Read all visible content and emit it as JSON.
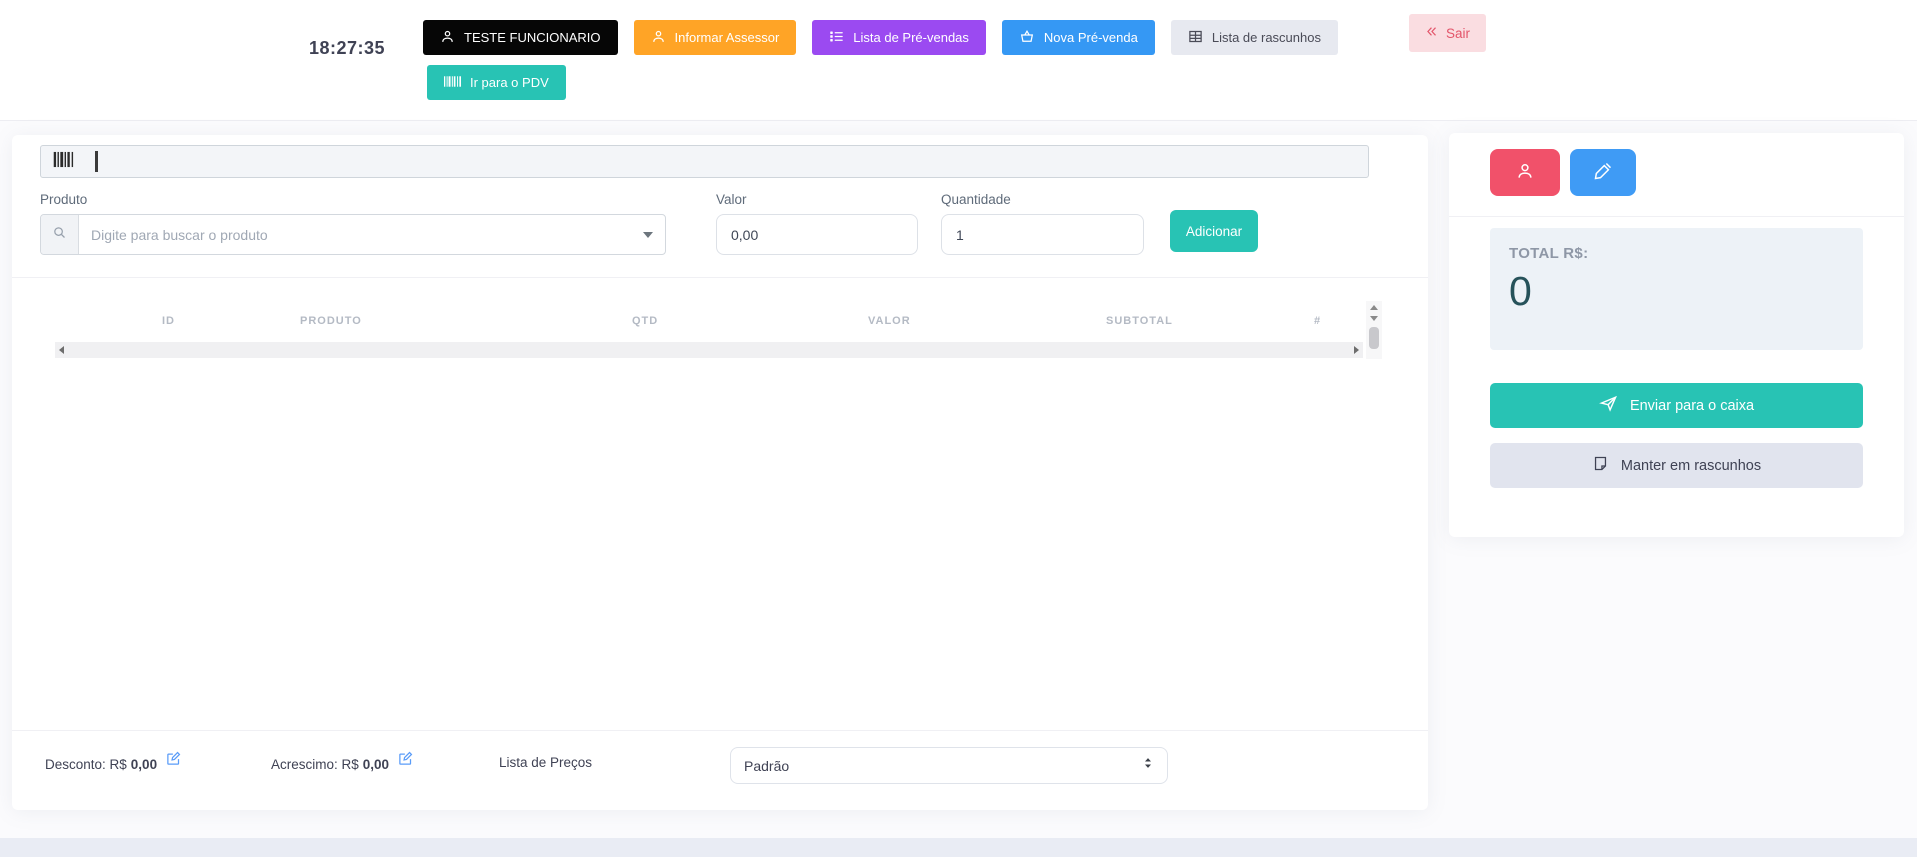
{
  "header": {
    "clock": "18:27:35",
    "buttons": {
      "employee": "TESTE FUNCIONARIO",
      "advisor": "Informar Assessor",
      "presale_list": "Lista de Pré-vendas",
      "new_presale": "Nova Pré-venda",
      "drafts_list": "Lista de rascunhos",
      "exit": "Sair",
      "go_pdv": "Ir para o PDV"
    }
  },
  "product_form": {
    "product_label": "Produto",
    "product_placeholder": "Digite para buscar o produto",
    "value_field": {
      "label": "Valor",
      "value": "0,00"
    },
    "quantity_field": {
      "label": "Quantidade",
      "value": "1"
    },
    "add_button": "Adicionar"
  },
  "items_table": {
    "columns": [
      "ID",
      "PRODUTO",
      "QTD",
      "VALOR",
      "SUBTOTAL",
      "#"
    ],
    "rows": []
  },
  "summary": {
    "total_label": "TOTAL R$:",
    "total_value": "0",
    "send_button": "Enviar para o caixa",
    "draft_button": "Manter em rascunhos"
  },
  "adjustments": {
    "discount_label": "Desconto: R$",
    "discount_value": "0,00",
    "addition_label": "Acrescimo: R$",
    "addition_value": "0,00",
    "price_list_label": "Lista de Preços",
    "price_list_selected": "Padrão"
  },
  "icons": {
    "person": "person-icon",
    "list": "list-icon",
    "basket": "basket-icon",
    "table": "table-icon",
    "chevrons_left": "chevrons-left-icon",
    "barcode": "barcode-icon",
    "search": "search-icon",
    "caret_down": "caret-down-icon",
    "pen": "pen-icon",
    "send": "send-icon",
    "note": "note-icon",
    "edit": "edit-square-icon",
    "updown": "up-down-icon"
  },
  "colors": {
    "black_button": "#060606",
    "orange_button": "#ffa426",
    "purple_button": "#9b4af1",
    "blue_button": "#3598f4",
    "gray_button": "#e7e9f0",
    "teal_button": "#28c3b4",
    "exit_bg": "#fadde1",
    "exit_text": "#e3556a",
    "red_button": "#f1516a",
    "panel_bg": "#edf2f7",
    "total_text": "#26525a",
    "draft_bg": "#e1e4ee",
    "edit_icon": "#5a9cf8",
    "footer_bar": "#e9ecf4"
  }
}
